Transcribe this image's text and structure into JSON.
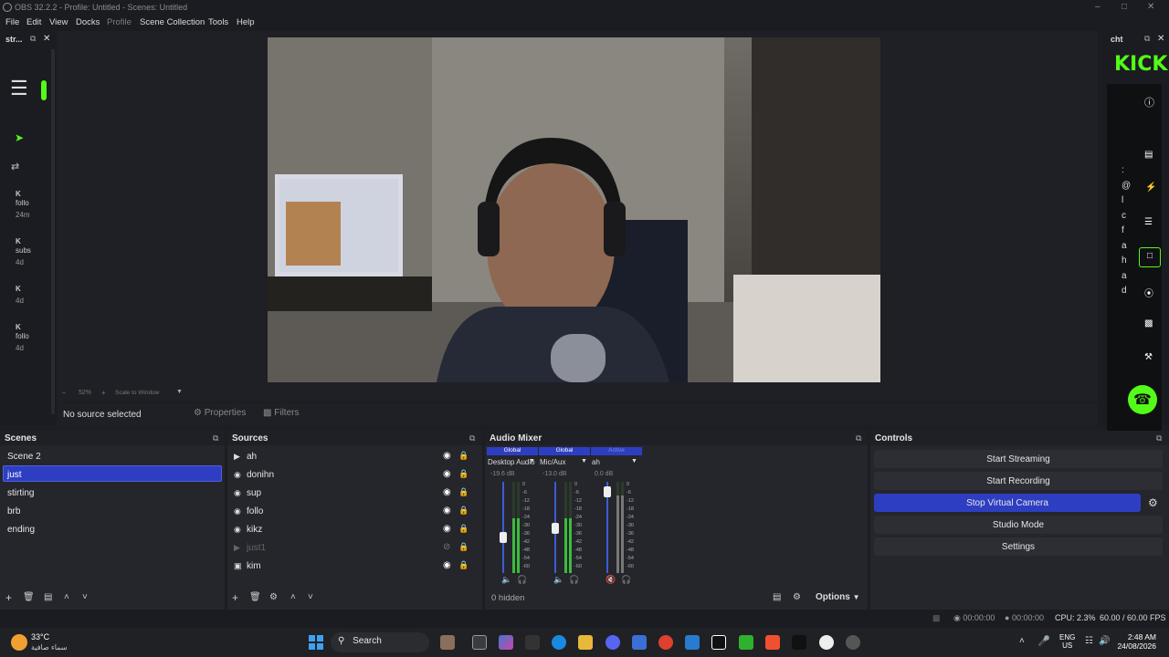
{
  "window": {
    "title": "OBS 32.2.2 - Profile: Untitled - Scenes: Untitled"
  },
  "menu": [
    {
      "label": "File",
      "dim": false
    },
    {
      "label": "Edit",
      "dim": false
    },
    {
      "label": "View",
      "dim": false
    },
    {
      "label": "Docks",
      "dim": false
    },
    {
      "label": "Profile",
      "dim": true
    },
    {
      "label": "Scene Collection",
      "dim": false
    },
    {
      "label": "Tools",
      "dim": false
    },
    {
      "label": "Help",
      "dim": false
    }
  ],
  "left_dock": {
    "title": "str...",
    "items": [
      {
        "line1": "K",
        "line2": "follo",
        "time": "24m"
      },
      {
        "line1": "K",
        "line2": "subs",
        "time": "4d"
      },
      {
        "line1": "K",
        "line2": "",
        "time": "4d"
      },
      {
        "line1": "K",
        "line2": "follo",
        "time": "4d"
      }
    ]
  },
  "right_dock": {
    "title": "cht",
    "brand": "KICK",
    "chars": [
      ":",
      "@",
      "l",
      "c",
      "f",
      "a",
      "h",
      "a",
      "d"
    ]
  },
  "preview_bar": {
    "zoom": "52%",
    "scale_label": "Scale to Window"
  },
  "source_bar": {
    "status": "No source selected",
    "properties": "Properties",
    "filters": "Filters"
  },
  "scenes": {
    "title": "Scenes",
    "items": [
      "Scene 2",
      "just",
      "stirting",
      "brb",
      "ending"
    ],
    "selected_index": 1
  },
  "sources": {
    "title": "Sources",
    "items": [
      {
        "name": "ah",
        "icon": "play-icon",
        "hidden": false
      },
      {
        "name": "donihn",
        "icon": "browser-icon",
        "hidden": false
      },
      {
        "name": "sup",
        "icon": "browser-icon",
        "hidden": false
      },
      {
        "name": "follo",
        "icon": "browser-icon",
        "hidden": false
      },
      {
        "name": "kikz",
        "icon": "browser-icon",
        "hidden": false
      },
      {
        "name": "just1",
        "icon": "play-icon",
        "hidden": true
      },
      {
        "name": "kim",
        "icon": "camera-icon",
        "hidden": false
      }
    ]
  },
  "audio_mixer": {
    "title": "Audio Mixer",
    "channels": [
      {
        "tag": "Global",
        "name": "Desktop Audio",
        "db": "-19.6 dB",
        "level": 0.45
      },
      {
        "tag": "Global",
        "name": "Mic/Aux",
        "db": "-13.0 dB",
        "level": 0.55
      },
      {
        "tag": "Active",
        "name": "ah",
        "db": "0.0 dB",
        "level": 0.95
      }
    ],
    "scale": [
      "0",
      "-6",
      "-12",
      "-18",
      "-24",
      "-30",
      "-36",
      "-42",
      "-48",
      "-54",
      "-60"
    ],
    "hidden_label": "0 hidden",
    "options": "Options"
  },
  "controls": {
    "title": "Controls",
    "buttons": [
      "Start Streaming",
      "Start Recording",
      "Stop Virtual Camera",
      "Studio Mode",
      "Settings"
    ],
    "active_index": 2
  },
  "status": {
    "rec_time": "00:00:00",
    "stream_time": "00:00:00",
    "cpu": "CPU: 2.3%",
    "fps": "60.00 / 60.00 FPS"
  },
  "taskbar": {
    "weather_temp": "33°C",
    "weather_desc": "سماء صافية",
    "search": "Search",
    "lang1": "ENG",
    "lang2": "US",
    "time": "2:48 AM",
    "date": "24/08/2026"
  },
  "colors": {
    "accent": "#2e3ec2",
    "kick": "#53fc18",
    "panel": "#25262c"
  }
}
